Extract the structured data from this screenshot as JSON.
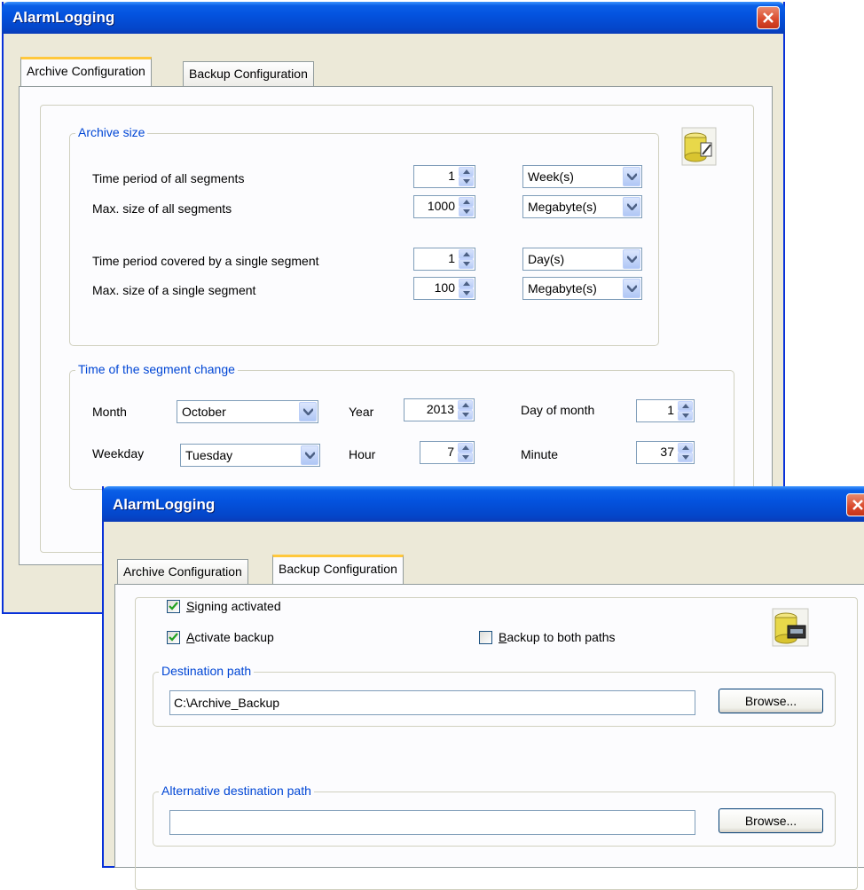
{
  "dialog1": {
    "title": "AlarmLogging",
    "tabs": [
      "Archive Configuration",
      "Backup Configuration"
    ],
    "archive_size": {
      "legend": "Archive size",
      "rows": [
        {
          "label": "Time period of all segments",
          "value": "1",
          "unit": "Week(s)"
        },
        {
          "label": "Max. size of all segments",
          "value": "1000",
          "unit": "Megabyte(s)"
        },
        {
          "label": "Time period covered by a single segment",
          "value": "1",
          "unit": "Day(s)"
        },
        {
          "label": "Max. size of a single segment",
          "value": "100",
          "unit": "Megabyte(s)"
        }
      ]
    },
    "segment_change": {
      "legend": "Time of the segment change",
      "month_label": "Month",
      "month_value": "October",
      "year_label": "Year",
      "year_value": "2013",
      "day_label": "Day of month",
      "day_value": "1",
      "weekday_label": "Weekday",
      "weekday_value": "Tuesday",
      "hour_label": "Hour",
      "hour_value": "7",
      "minute_label": "Minute",
      "minute_value": "37"
    }
  },
  "dialog2": {
    "title": "AlarmLogging",
    "tabs": [
      "Archive Configuration",
      "Backup Configuration"
    ],
    "signing": {
      "label_first": "S",
      "label_rest": "igning activated",
      "checked": true
    },
    "activate": {
      "label_first": "A",
      "label_rest": "ctivate backup",
      "checked": true
    },
    "both": {
      "label_first": "B",
      "label_rest": "ackup to both paths",
      "checked": false
    },
    "dest": {
      "legend": "Destination path",
      "value": "C:\\Archive_Backup",
      "browse": "Browse..."
    },
    "alt": {
      "legend": "Alternative destination path",
      "value": "",
      "browse": "Browse..."
    }
  },
  "colors": {
    "title_blue": "#0453df",
    "legend_blue": "#0046d5",
    "close_red": "#d9482b",
    "tab_highlight": "#ffc83c"
  },
  "icons": [
    "archive-edit-icon",
    "archive-backup-icon",
    "close-icon",
    "spin-arrows-icon",
    "dropdown-arrow-icon",
    "checkmark-icon"
  ]
}
